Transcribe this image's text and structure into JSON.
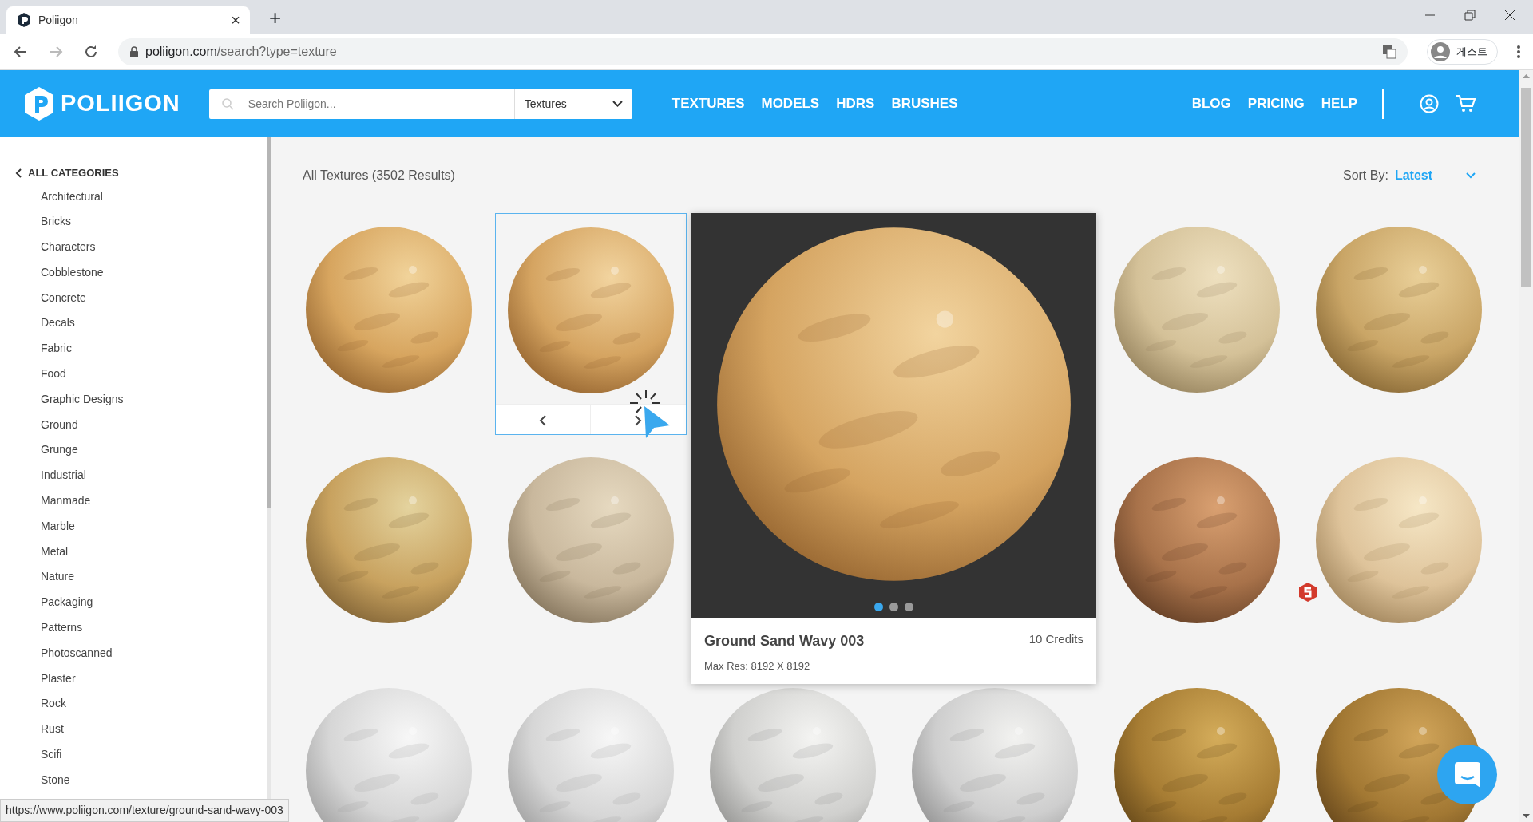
{
  "browser": {
    "tab_title": "Poliigon",
    "tab_close": "×",
    "new_tab": "+",
    "url_host": "poliigon.com",
    "url_path": "/search?type=texture",
    "forward_enabled": false,
    "profile": "게스트",
    "status_url": "https://www.poliigon.com/texture/ground-sand-wavy-003"
  },
  "header": {
    "logo": "POLIIGON",
    "search": {
      "placeholder": "Search Poliigon..."
    },
    "type_select": "Textures",
    "nav": [
      "TEXTURES",
      "MODELS",
      "HDRS",
      "BRUSHES"
    ],
    "nav_right": [
      "BLOG",
      "PRICING",
      "HELP"
    ]
  },
  "sidebar": {
    "back": "ALL CATEGORIES",
    "categories": [
      "Architectural",
      "Bricks",
      "Characters",
      "Cobblestone",
      "Concrete",
      "Decals",
      "Fabric",
      "Food",
      "Graphic Designs",
      "Ground",
      "Grunge",
      "Industrial",
      "Manmade",
      "Marble",
      "Metal",
      "Nature",
      "Packaging",
      "Patterns",
      "Photoscanned",
      "Plaster",
      "Rock",
      "Rust",
      "Scifi",
      "Stone"
    ]
  },
  "results": {
    "title": "All Textures (3502 Results)",
    "sort_label": "Sort By:",
    "sort_value": "Latest"
  },
  "tiles": [
    {
      "hovered": false,
      "badge": false
    },
    {
      "hovered": true,
      "badge": false
    },
    {
      "hovered": false,
      "badge": false
    },
    {
      "hovered": false,
      "badge": false
    },
    {
      "hovered": false,
      "badge": false
    },
    {
      "hovered": false,
      "badge": false
    },
    {
      "hovered": false,
      "badge": false
    },
    {
      "hovered": false,
      "badge": true
    },
    {
      "hovered": false,
      "badge": false
    },
    {
      "hovered": false,
      "badge": false
    },
    {
      "hovered": false,
      "badge": false
    },
    {
      "hovered": false,
      "badge": false
    },
    {
      "hovered": false,
      "badge": false
    },
    {
      "hovered": false,
      "badge": false
    }
  ],
  "preview": {
    "title": "Ground Sand Wavy 003",
    "price": "10 Credits",
    "max_res": "Max Res: 8192 X 8192",
    "dots": [
      {
        "selected": true
      },
      {
        "selected": false
      },
      {
        "selected": false
      }
    ]
  }
}
